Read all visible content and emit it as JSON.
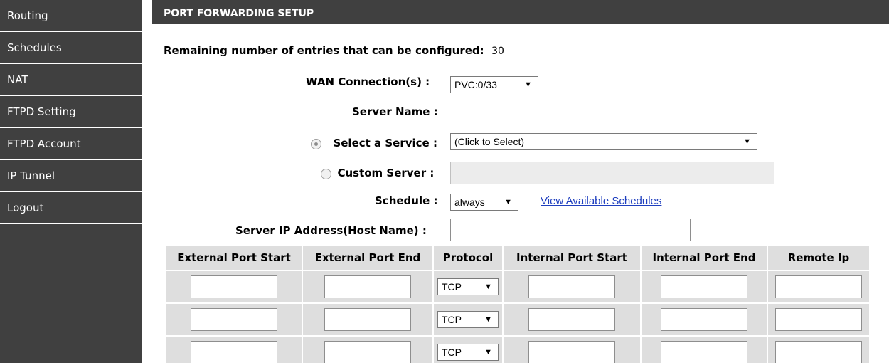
{
  "sidebar": {
    "items": [
      {
        "label": "Routing"
      },
      {
        "label": "Schedules"
      },
      {
        "label": "NAT"
      },
      {
        "label": "FTPD Setting"
      },
      {
        "label": "FTPD Account"
      },
      {
        "label": "IP Tunnel"
      },
      {
        "label": "Logout"
      }
    ]
  },
  "section": {
    "title": "PORT FORWARDING SETUP"
  },
  "form": {
    "remaining_label": "Remaining number of entries that can be configured:",
    "remaining_value": "30",
    "wan_label": "WAN Connection(s) :",
    "wan_value": "PVC:0/33",
    "server_name_label": "Server Name :",
    "select_service_label": "Select a Service :",
    "select_service_value": "(Click to Select)",
    "select_service_checked": true,
    "custom_server_label": "Custom Server :",
    "custom_server_value": "",
    "schedule_label": "Schedule :",
    "schedule_value": "always",
    "view_schedules_link": "View Available Schedules",
    "server_ip_label": "Server IP Address(Host Name) :",
    "server_ip_value": ""
  },
  "table": {
    "headers": [
      "External Port Start",
      "External Port End",
      "Protocol",
      "Internal Port Start",
      "Internal Port End",
      "Remote Ip"
    ],
    "rows": [
      {
        "ext_start": "",
        "ext_end": "",
        "protocol": "TCP",
        "int_start": "",
        "int_end": "",
        "remote_ip": ""
      },
      {
        "ext_start": "",
        "ext_end": "",
        "protocol": "TCP",
        "int_start": "",
        "int_end": "",
        "remote_ip": ""
      },
      {
        "ext_start": "",
        "ext_end": "",
        "protocol": "TCP",
        "int_start": "",
        "int_end": "",
        "remote_ip": ""
      }
    ]
  },
  "colors": {
    "sidebar_bg": "#404040",
    "header_bg": "#404040",
    "table_cell_bg": "#dedede",
    "link": "#1f3fbf"
  },
  "icons": {
    "dropdown_arrow": "▼",
    "radio": "radio-button"
  }
}
